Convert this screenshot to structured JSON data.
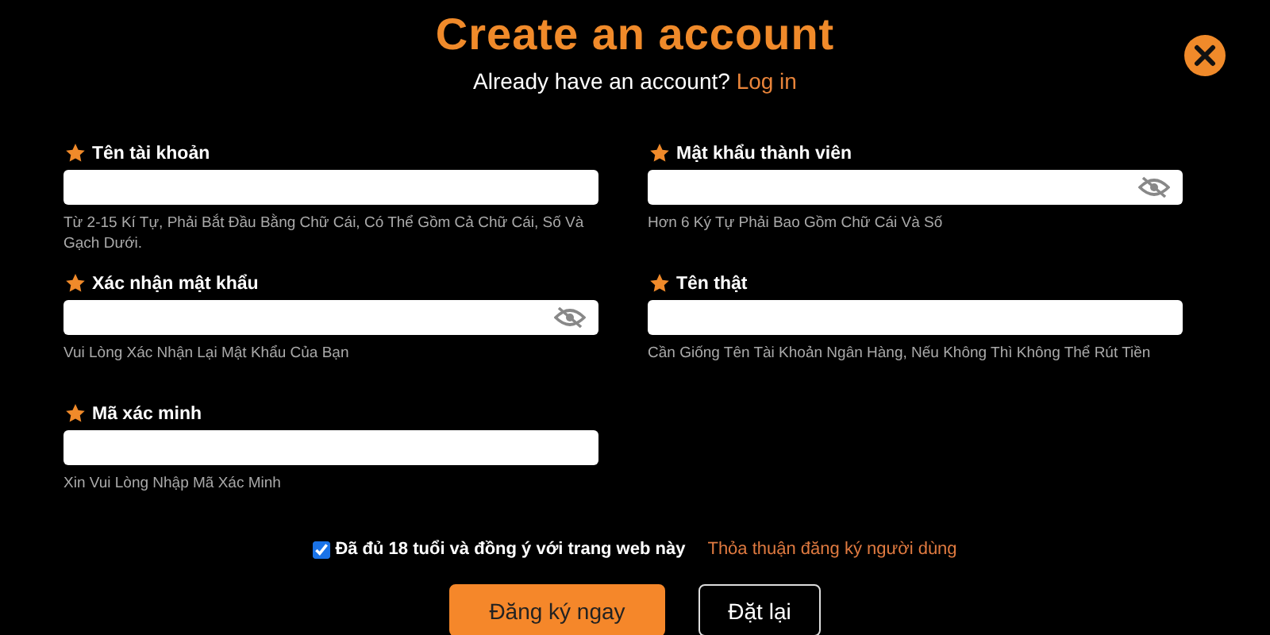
{
  "dialog": {
    "title": "Create an account",
    "login_prompt": "Already have an account?",
    "login_link": "Log in"
  },
  "fields": [
    {
      "label": "Tên tài khoản",
      "kind": "text",
      "hint": "Từ 2-15 Kí Tự, Phải Bắt Đầu Bằng Chữ Cái, Có Thể Gồm Cả Chữ Cái, Số Và Gạch Dưới."
    },
    {
      "label": "Mật khẩu thành viên",
      "kind": "password",
      "hint": "Hơn 6 Ký Tự Phải Bao Gồm Chữ Cái Và Số"
    },
    {
      "label": "Xác nhận mật khẩu",
      "kind": "password",
      "hint": "Vui Lòng Xác Nhận Lại Mật Khẩu Của Bạn"
    },
    {
      "label": "Tên thật",
      "kind": "text",
      "hint": "Cần Giống Tên Tài Khoản Ngân Hàng, Nếu Không Thì Không Thể Rút Tiền"
    },
    {
      "label": "Mã xác minh",
      "kind": "text",
      "hint": "Xin Vui Lòng Nhập Mã Xác Minh"
    }
  ],
  "agreement": {
    "checked": true,
    "label": "Đã đủ 18 tuổi và đồng ý với trang web này",
    "link": "Thỏa thuận đăng ký người dùng"
  },
  "buttons": [
    {
      "label": "Đăng ký ngay",
      "kind": "primary"
    },
    {
      "label": "Đặt lại",
      "kind": "secondary"
    }
  ]
}
